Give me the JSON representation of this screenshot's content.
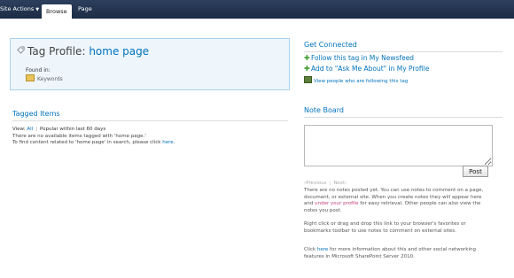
{
  "ribbon": {
    "site_actions": "Site Actions",
    "tab_browse": "Browse",
    "tab_page": "Page"
  },
  "profile": {
    "title_prefix": "Tag Profile:",
    "tag_name": "home page",
    "found_in_label": "Found in:",
    "found_in_value": "Keywords"
  },
  "tagged": {
    "title": "Tagged Items",
    "view_label": "View:",
    "view_all": "All",
    "view_popular": "Popular within last 60 days",
    "no_items": "There are no available items tagged with 'home page.'",
    "find_text": "To find content related to 'home page' in search, please click",
    "find_link": "here."
  },
  "connected": {
    "title": "Get Connected",
    "follow": "Follow this tag in My Newsfeed",
    "ask": "Add to \"Ask Me About\" in My Profile",
    "view_people": "View people who are following this tag"
  },
  "noteboard": {
    "title": "Note Board",
    "post_label": "Post",
    "previous": "‹Previous",
    "next": "Next›",
    "p1_a": "There are no notes posted yet. You can use notes to comment on a page, document, or external site. When you create notes they will appear here and",
    "p1_link": "under your profile",
    "p1_b": "for easy retrieval. Other people can also view the notes you post.",
    "p2": "Right click or drag and drop this link to your browser's favorites or bookmarks toolbar to use notes to comment on external sites.",
    "p3_a": "Click",
    "p3_link": "here",
    "p3_b": "for more information about this and other social networking features in Microsoft SharePoint Server 2010."
  },
  "colors": {
    "ribbon_bg": "#1d2c44",
    "link": "#0072bc",
    "profile_bg": "#eef6fc",
    "profile_border": "#aad3ee",
    "plus_green": "#3f9d2d"
  },
  "icons": {
    "tag": "tag-icon",
    "keywords": "keywords-icon",
    "follow": "plus-icon",
    "ask": "plus-icon",
    "people": "people-icon"
  }
}
